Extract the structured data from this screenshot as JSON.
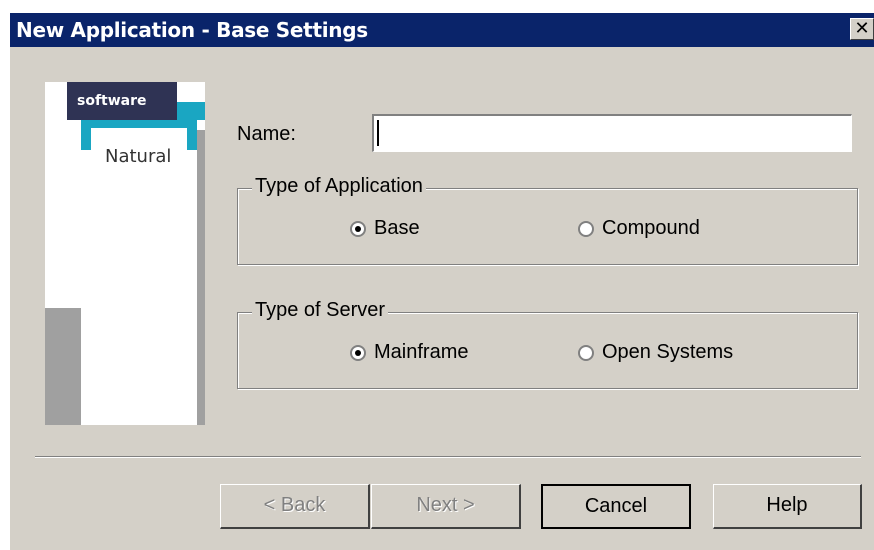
{
  "window": {
    "title": "New Application - Base Settings",
    "close_glyph": "✕"
  },
  "logo": {
    "brand": "software",
    "product": "Natural"
  },
  "form": {
    "name_label": "Name:",
    "name_value": "",
    "application_group": {
      "legend": "Type of Application",
      "options": [
        {
          "label": "Base",
          "selected": true
        },
        {
          "label": "Compound",
          "selected": false
        }
      ]
    },
    "server_group": {
      "legend": "Type of Server",
      "options": [
        {
          "label": "Mainframe",
          "selected": true
        },
        {
          "label": "Open Systems",
          "selected": false
        }
      ]
    }
  },
  "buttons": {
    "back": "< Back",
    "next": "Next >",
    "cancel": "Cancel",
    "help": "Help"
  },
  "colors": {
    "titlebar": "#0a246a",
    "dialog_bg": "#d4d0c8",
    "logo_dark": "#2f3354",
    "logo_teal": "#1aa6c2"
  }
}
